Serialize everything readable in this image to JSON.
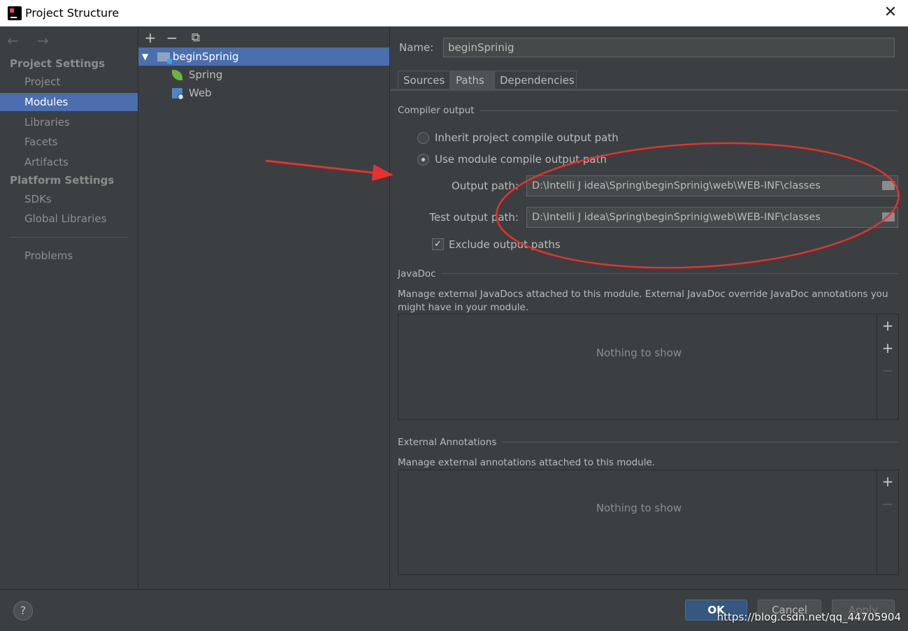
{
  "window": {
    "title": "Project Structure",
    "close_glyph": "✕"
  },
  "sidebar": {
    "nav_arrows": "← →",
    "project_settings_header": "Project Settings",
    "platform_settings_header": "Platform Settings",
    "items": [
      {
        "label": "Project"
      },
      {
        "label": "Modules"
      },
      {
        "label": "Libraries"
      },
      {
        "label": "Facets"
      },
      {
        "label": "Artifacts"
      },
      {
        "label": "SDKs"
      },
      {
        "label": "Global Libraries"
      },
      {
        "label": "Problems"
      }
    ],
    "selected": "Modules"
  },
  "modules": {
    "toolbar": {
      "add": "+",
      "remove": "−",
      "copy": "⧉"
    },
    "tree": [
      {
        "label": "beginSprinig",
        "icon": "module-folder-icon",
        "expanded": true
      },
      {
        "label": "Spring",
        "icon": "spring-leaf-icon"
      },
      {
        "label": "Web",
        "icon": "web-facet-icon"
      }
    ]
  },
  "detail": {
    "name_label": "Name:",
    "name_value": "beginSprinig",
    "tabs": [
      {
        "label": "Sources"
      },
      {
        "label": "Paths"
      },
      {
        "label": "Dependencies"
      }
    ],
    "active_tab": "Paths",
    "compiler_output": {
      "title": "Compiler output",
      "inherit_label": "Inherit project compile output path",
      "use_module_label": "Use module compile output path",
      "selected": "use_module",
      "output_path_label": "Output path:",
      "output_path": "D:\\Intelli J idea\\Spring\\beginSprinig\\web\\WEB-INF\\classes",
      "test_output_path_label": "Test output path:",
      "test_output_path": "D:\\Intelli J idea\\Spring\\beginSprinig\\web\\WEB-INF\\classes",
      "exclude_label": "Exclude output paths",
      "exclude_checked": true
    },
    "javadoc": {
      "title": "JavaDoc",
      "description": "Manage external JavaDocs attached to this module. External JavaDoc override JavaDoc annotations you might have in your module.",
      "empty_text": "Nothing to show"
    },
    "external_annotations": {
      "title": "External Annotations",
      "description": "Manage external annotations attached to this module.",
      "empty_text": "Nothing to show"
    }
  },
  "footer": {
    "help": "?",
    "ok": "OK",
    "cancel": "Cancel",
    "apply": "Apply",
    "watermark": "https://blog.csdn.net/qq_44705904"
  },
  "colors": {
    "background": "#3c3f41",
    "selection": "#4b6eaf",
    "annotation_red": "#e8312f",
    "ok_button": "#365880"
  }
}
